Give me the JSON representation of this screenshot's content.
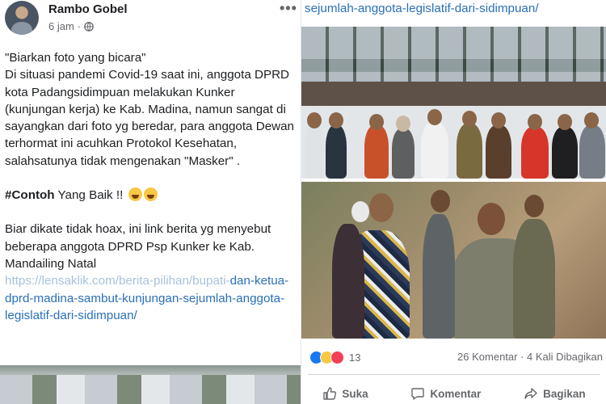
{
  "post": {
    "author": "Rambo Gobel",
    "time": "6 jam",
    "separator": "·",
    "lines": [
      "\"Biarkan foto yang bicara\"",
      "Di situasi pandemi Covid-19 saat ini, anggota DPRD kota Padangsidimpuan melakukan Kunker (kunjungan kerja) ke Kab. Madina, namun sangat di sayangkan dari foto yg beredar, para anggota Dewan terhormat ini acuhkan Protokol Kesehatan, salahsatunya tidak mengenakan \"Masker\" ."
    ],
    "hashtag": "#Contoh",
    "hashtag_rest": " Yang Baik !!",
    "body2": "Biar dikate tidak hoax, ini link berita yg menyebut beberapa anggota DPRD Psp Kunker ke Kab. Mandailing Natal",
    "link_faded": "https://lensaklik.com/berita-pilihan/bupati-",
    "link": "dan-ketua-dprd-madina-sambut-kunjungan-sejumlah-anggota-legislatif-dari-sidimpuan/"
  },
  "right": {
    "url_line": "sejumlah-anggota-legislatif-dari-sidimpuan/",
    "reactions_count": "13",
    "comments": "26 Komentar",
    "shares": "4 Kali Dibagikan",
    "stats_sep": " · ",
    "actions": {
      "like": "Suka",
      "comment": "Komentar",
      "share": "Bagikan"
    }
  },
  "colors": {
    "link": "#2a6fb7",
    "muted": "#65676b",
    "like": "#1877f2",
    "love": "#f33e58",
    "haha": "#f7c843"
  },
  "icons": [
    "globe-icon",
    "more-dots-icon",
    "like-icon",
    "comment-icon",
    "share-icon"
  ]
}
